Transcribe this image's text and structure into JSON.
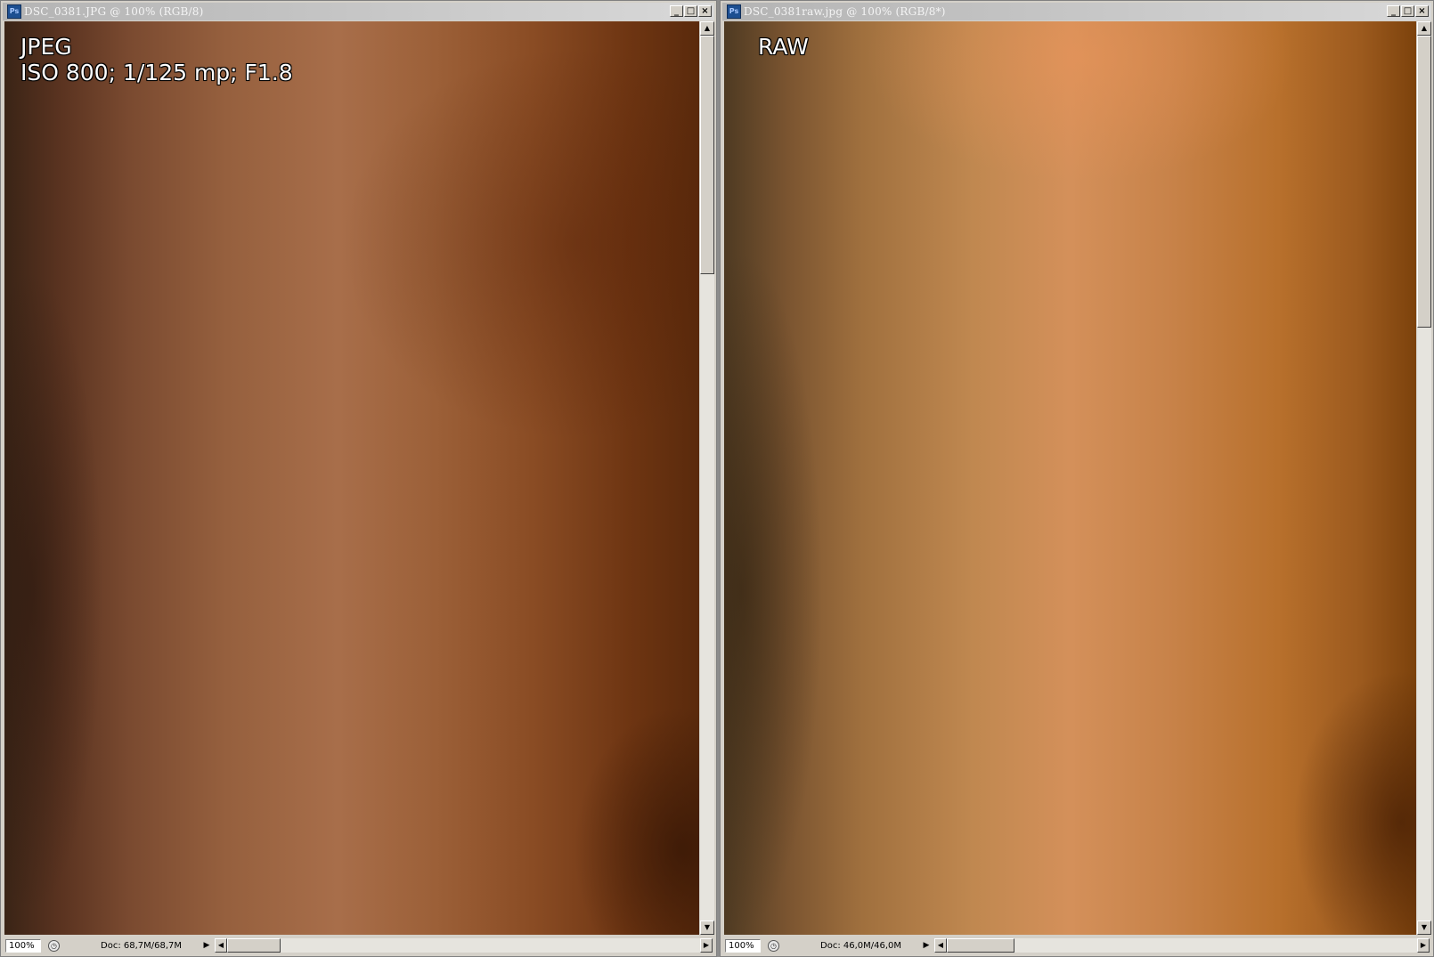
{
  "windows": [
    {
      "title": "DSC_0381.JPG @ 100% (RGB/8)",
      "overlay_lines": [
        "JPEG",
        "ISO 800; 1/125 mp; F1.8"
      ],
      "zoom": "100%",
      "doc_info": "Doc: 68,7M/68,7M",
      "vscroll_position": 0.0,
      "vscroll_visible_fraction": 0.27
    },
    {
      "title": "DSC_0381raw.jpg @ 100% (RGB/8*)",
      "overlay_lines": [
        "RAW"
      ],
      "zoom": "100%",
      "doc_info": "Doc: 46,0M/46,0M",
      "vscroll_position": 0.0,
      "vscroll_visible_fraction": 0.33
    }
  ],
  "app_icon_text": "Ps",
  "window_buttons": {
    "minimize": "_",
    "maximize": "□",
    "close": "×"
  },
  "icons": {
    "app": "photoshop-icon",
    "minimize": "minimize-icon",
    "maximize": "maximize-icon",
    "close": "close-icon",
    "scroll_up": "arrow-up-icon",
    "scroll_down": "arrow-down-icon",
    "scroll_left": "arrow-left-icon",
    "scroll_right": "arrow-right-icon",
    "status_menu": "status-menu-arrow-icon",
    "status_info": "status-info-icon"
  },
  "glyphs": {
    "up": "▲",
    "down": "▼",
    "left": "◀",
    "right": "▶",
    "status": "◷"
  }
}
